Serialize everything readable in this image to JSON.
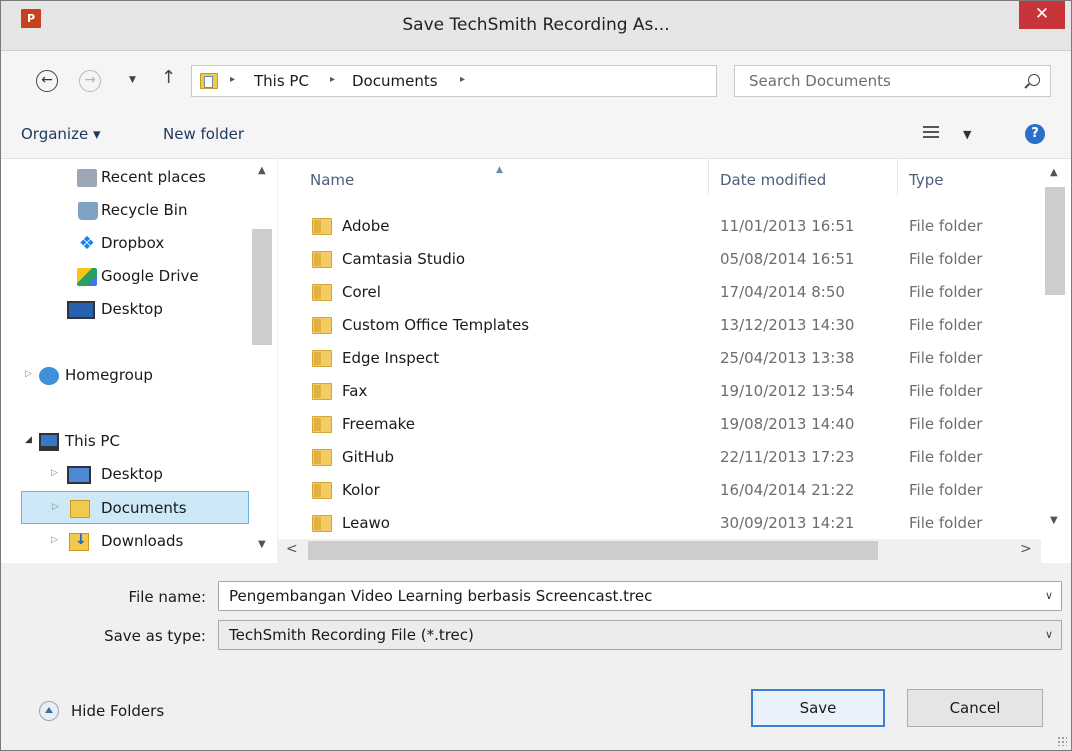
{
  "window": {
    "title": "Save TechSmith Recording As...",
    "app_icon_text": "P",
    "close_symbol": "✕"
  },
  "address": {
    "back_symbol": "←",
    "forward_symbol": "→",
    "recent_symbol": "▼",
    "up_symbol": "↑",
    "crumbs": [
      "This PC",
      "Documents"
    ],
    "separator": "▸",
    "dropdown_symbol": "∨",
    "refresh_symbol": "↻"
  },
  "search": {
    "placeholder": "Search Documents"
  },
  "toolbar": {
    "organize": "Organize ▾",
    "new_folder": "New folder",
    "view_caret": "▼",
    "help": "?"
  },
  "nav": {
    "items": [
      {
        "label": "Recent places"
      },
      {
        "label": "Recycle Bin"
      },
      {
        "label": "Dropbox"
      },
      {
        "label": "Google Drive"
      },
      {
        "label": "Desktop"
      },
      {
        "label": "Homegroup"
      },
      {
        "label": "This PC"
      },
      {
        "label": "Desktop"
      },
      {
        "label": "Documents"
      },
      {
        "label": "Downloads"
      }
    ],
    "dropbox_glyph": "❖",
    "expand_collapsed": "▷",
    "expand_open": "◢"
  },
  "list": {
    "columns": {
      "name": "Name",
      "date": "Date modified",
      "type": "Type"
    },
    "sort_indicator": "▲",
    "rows": [
      {
        "name": "Adobe",
        "date": "11/01/2013 16:51",
        "type": "File folder"
      },
      {
        "name": "Camtasia Studio",
        "date": "05/08/2014 16:51",
        "type": "File folder"
      },
      {
        "name": "Corel",
        "date": "17/04/2014 8:50",
        "type": "File folder"
      },
      {
        "name": "Custom Office Templates",
        "date": "13/12/2013 14:30",
        "type": "File folder"
      },
      {
        "name": "Edge Inspect",
        "date": "25/04/2013 13:38",
        "type": "File folder"
      },
      {
        "name": "Fax",
        "date": "19/10/2012 13:54",
        "type": "File folder"
      },
      {
        "name": "Freemake",
        "date": "19/08/2013 14:40",
        "type": "File folder"
      },
      {
        "name": "GitHub",
        "date": "22/11/2013 17:23",
        "type": "File folder"
      },
      {
        "name": "Kolor",
        "date": "16/04/2014 21:22",
        "type": "File folder"
      },
      {
        "name": "Leawo",
        "date": "30/09/2013 14:21",
        "type": "File folder"
      }
    ],
    "scroll": {
      "up": "▲",
      "down": "▼",
      "left": "<",
      "right": ">"
    }
  },
  "form": {
    "file_name_label": "File name:",
    "file_name_value": "Pengembangan Video Learning berbasis Screencast.trec",
    "save_type_label": "Save as type:",
    "save_type_value": "TechSmith Recording File (*.trec)",
    "dropdown_symbol": "∨"
  },
  "footer": {
    "hide_folders": "Hide Folders",
    "save": "Save",
    "cancel": "Cancel"
  },
  "colors": {
    "accent": "#3c7fd0",
    "close": "#c7343a",
    "selection": "#cde8f7"
  }
}
